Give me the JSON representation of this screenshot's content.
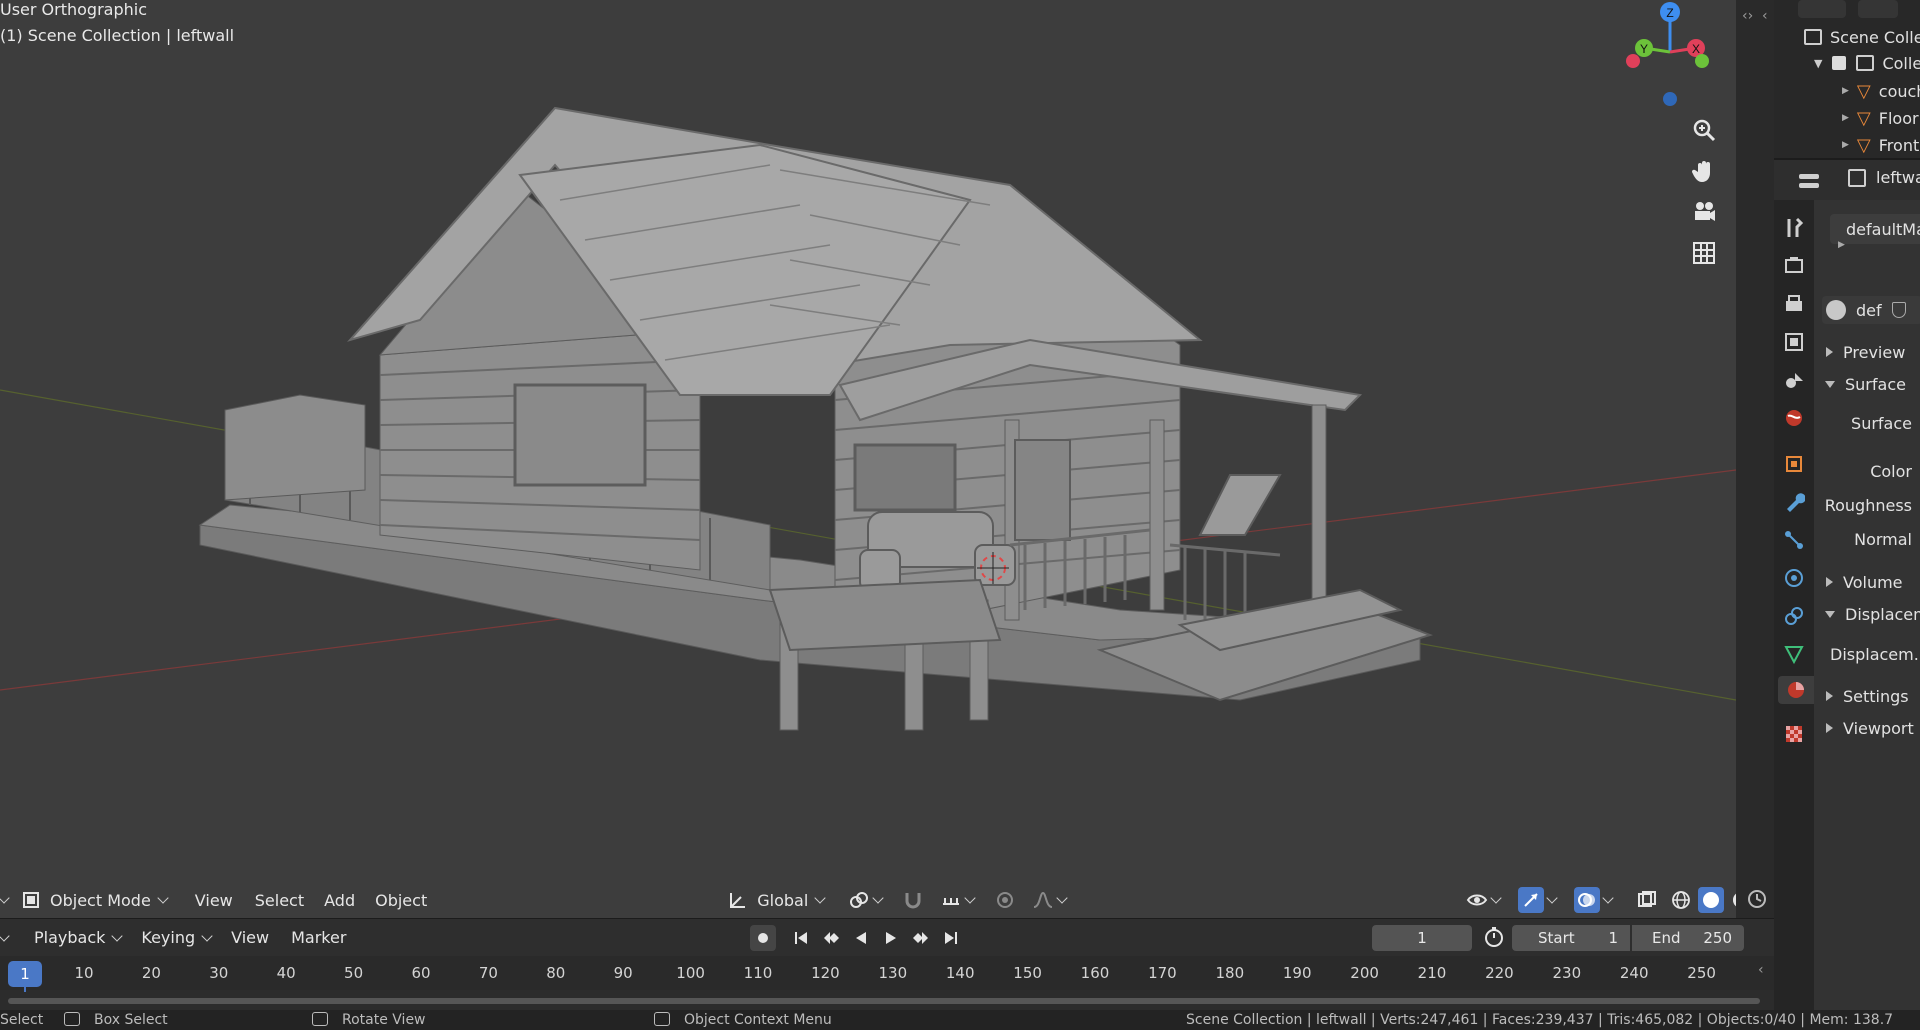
{
  "viewport": {
    "view_name": "User Orthographic",
    "collection_info": "(1) Scene Collection | leftwall",
    "gizmo_axes": {
      "z": "Z",
      "y": "Y",
      "x": "X"
    },
    "tools": [
      "zoom-icon",
      "hand-icon",
      "camera-icon",
      "grid-icon"
    ],
    "header": {
      "mode": "Object Mode",
      "menus": [
        "View",
        "Select",
        "Add",
        "Object"
      ],
      "orientation": "Global"
    }
  },
  "timeline": {
    "menus": [
      "Playback",
      "Keying",
      "View",
      "Marker"
    ],
    "current_frame": "1",
    "start_label": "Start",
    "start_value": "1",
    "end_label": "End",
    "end_value": "250",
    "ruler_ticks": [
      "10",
      "20",
      "30",
      "40",
      "50",
      "60",
      "70",
      "80",
      "90",
      "100",
      "110",
      "120",
      "130",
      "140",
      "150",
      "160",
      "170",
      "180",
      "190",
      "200",
      "210",
      "220",
      "230",
      "240",
      "250"
    ]
  },
  "statusbar": {
    "select": "Select",
    "box_select": "Box Select",
    "rotate_view": "Rotate View",
    "context_menu": "Object Context Menu",
    "stats": "Scene Collection | leftwall | Verts:247,461 | Faces:239,437 | Tris:465,082 | Objects:0/40 | Mem: 138.7"
  },
  "outliner": {
    "root": "Scene Collection",
    "collection": "Collection",
    "items": [
      "couch",
      "Floor",
      "Front"
    ]
  },
  "properties": {
    "object_name": "leftwall",
    "material_slot": "defaultMat",
    "material_name": "def",
    "sections": {
      "preview": "Preview",
      "surface": "Surface",
      "surface_field": "Surface",
      "color": "Color",
      "roughness": "Roughness",
      "normal": "Normal",
      "volume": "Volume",
      "displacement": "Displacement",
      "displacement_field": "Displacem...",
      "settings": "Settings",
      "viewport": "Viewport"
    }
  },
  "colors": {
    "accent_blue": "#4a78c6",
    "axis_x": "#e0405a",
    "axis_y": "#6cc23a",
    "axis_z": "#3e8ef0"
  }
}
